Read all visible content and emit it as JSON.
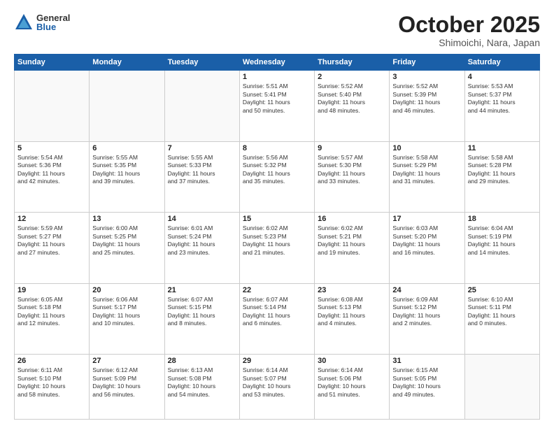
{
  "logo": {
    "general": "General",
    "blue": "Blue"
  },
  "header": {
    "month": "October 2025",
    "location": "Shimoichi, Nara, Japan"
  },
  "weekdays": [
    "Sunday",
    "Monday",
    "Tuesday",
    "Wednesday",
    "Thursday",
    "Friday",
    "Saturday"
  ],
  "weeks": [
    [
      {
        "day": "",
        "info": ""
      },
      {
        "day": "",
        "info": ""
      },
      {
        "day": "",
        "info": ""
      },
      {
        "day": "1",
        "info": "Sunrise: 5:51 AM\nSunset: 5:41 PM\nDaylight: 11 hours\nand 50 minutes."
      },
      {
        "day": "2",
        "info": "Sunrise: 5:52 AM\nSunset: 5:40 PM\nDaylight: 11 hours\nand 48 minutes."
      },
      {
        "day": "3",
        "info": "Sunrise: 5:52 AM\nSunset: 5:39 PM\nDaylight: 11 hours\nand 46 minutes."
      },
      {
        "day": "4",
        "info": "Sunrise: 5:53 AM\nSunset: 5:37 PM\nDaylight: 11 hours\nand 44 minutes."
      }
    ],
    [
      {
        "day": "5",
        "info": "Sunrise: 5:54 AM\nSunset: 5:36 PM\nDaylight: 11 hours\nand 42 minutes."
      },
      {
        "day": "6",
        "info": "Sunrise: 5:55 AM\nSunset: 5:35 PM\nDaylight: 11 hours\nand 39 minutes."
      },
      {
        "day": "7",
        "info": "Sunrise: 5:55 AM\nSunset: 5:33 PM\nDaylight: 11 hours\nand 37 minutes."
      },
      {
        "day": "8",
        "info": "Sunrise: 5:56 AM\nSunset: 5:32 PM\nDaylight: 11 hours\nand 35 minutes."
      },
      {
        "day": "9",
        "info": "Sunrise: 5:57 AM\nSunset: 5:30 PM\nDaylight: 11 hours\nand 33 minutes."
      },
      {
        "day": "10",
        "info": "Sunrise: 5:58 AM\nSunset: 5:29 PM\nDaylight: 11 hours\nand 31 minutes."
      },
      {
        "day": "11",
        "info": "Sunrise: 5:58 AM\nSunset: 5:28 PM\nDaylight: 11 hours\nand 29 minutes."
      }
    ],
    [
      {
        "day": "12",
        "info": "Sunrise: 5:59 AM\nSunset: 5:27 PM\nDaylight: 11 hours\nand 27 minutes."
      },
      {
        "day": "13",
        "info": "Sunrise: 6:00 AM\nSunset: 5:25 PM\nDaylight: 11 hours\nand 25 minutes."
      },
      {
        "day": "14",
        "info": "Sunrise: 6:01 AM\nSunset: 5:24 PM\nDaylight: 11 hours\nand 23 minutes."
      },
      {
        "day": "15",
        "info": "Sunrise: 6:02 AM\nSunset: 5:23 PM\nDaylight: 11 hours\nand 21 minutes."
      },
      {
        "day": "16",
        "info": "Sunrise: 6:02 AM\nSunset: 5:21 PM\nDaylight: 11 hours\nand 19 minutes."
      },
      {
        "day": "17",
        "info": "Sunrise: 6:03 AM\nSunset: 5:20 PM\nDaylight: 11 hours\nand 16 minutes."
      },
      {
        "day": "18",
        "info": "Sunrise: 6:04 AM\nSunset: 5:19 PM\nDaylight: 11 hours\nand 14 minutes."
      }
    ],
    [
      {
        "day": "19",
        "info": "Sunrise: 6:05 AM\nSunset: 5:18 PM\nDaylight: 11 hours\nand 12 minutes."
      },
      {
        "day": "20",
        "info": "Sunrise: 6:06 AM\nSunset: 5:17 PM\nDaylight: 11 hours\nand 10 minutes."
      },
      {
        "day": "21",
        "info": "Sunrise: 6:07 AM\nSunset: 5:15 PM\nDaylight: 11 hours\nand 8 minutes."
      },
      {
        "day": "22",
        "info": "Sunrise: 6:07 AM\nSunset: 5:14 PM\nDaylight: 11 hours\nand 6 minutes."
      },
      {
        "day": "23",
        "info": "Sunrise: 6:08 AM\nSunset: 5:13 PM\nDaylight: 11 hours\nand 4 minutes."
      },
      {
        "day": "24",
        "info": "Sunrise: 6:09 AM\nSunset: 5:12 PM\nDaylight: 11 hours\nand 2 minutes."
      },
      {
        "day": "25",
        "info": "Sunrise: 6:10 AM\nSunset: 5:11 PM\nDaylight: 11 hours\nand 0 minutes."
      }
    ],
    [
      {
        "day": "26",
        "info": "Sunrise: 6:11 AM\nSunset: 5:10 PM\nDaylight: 10 hours\nand 58 minutes."
      },
      {
        "day": "27",
        "info": "Sunrise: 6:12 AM\nSunset: 5:09 PM\nDaylight: 10 hours\nand 56 minutes."
      },
      {
        "day": "28",
        "info": "Sunrise: 6:13 AM\nSunset: 5:08 PM\nDaylight: 10 hours\nand 54 minutes."
      },
      {
        "day": "29",
        "info": "Sunrise: 6:14 AM\nSunset: 5:07 PM\nDaylight: 10 hours\nand 53 minutes."
      },
      {
        "day": "30",
        "info": "Sunrise: 6:14 AM\nSunset: 5:06 PM\nDaylight: 10 hours\nand 51 minutes."
      },
      {
        "day": "31",
        "info": "Sunrise: 6:15 AM\nSunset: 5:05 PM\nDaylight: 10 hours\nand 49 minutes."
      },
      {
        "day": "",
        "info": ""
      }
    ]
  ]
}
